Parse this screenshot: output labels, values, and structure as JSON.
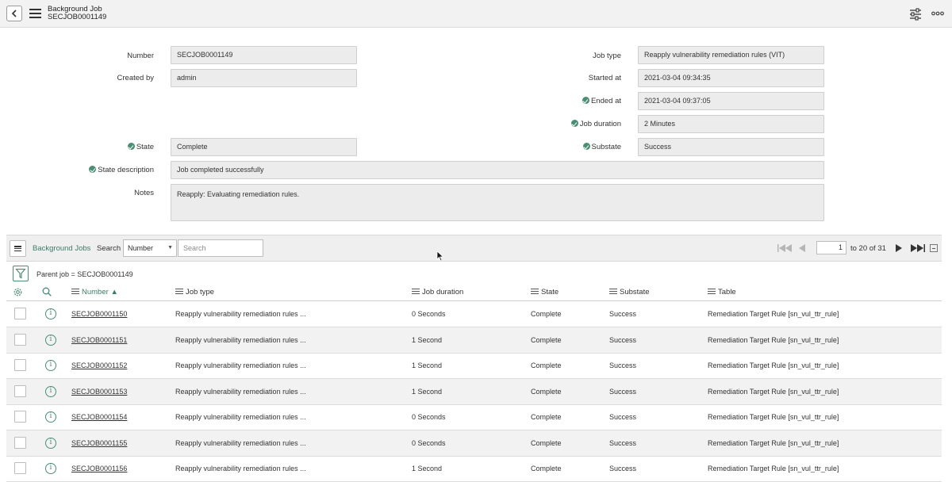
{
  "header": {
    "title": "Background Job",
    "subtitle": "SECJOB0001149",
    "back_icon": "chevron-left-icon",
    "menu_icon": "hamburger-icon",
    "settings_icon": "sliders-icon",
    "more_icon": "more-horizontal-icon"
  },
  "form": {
    "number_label": "Number",
    "number_value": "SECJOB0001149",
    "created_by_label": "Created by",
    "created_by_value": "admin",
    "job_type_label": "Job type",
    "job_type_value": "Reapply vulnerability remediation rules (VIT)",
    "started_at_label": "Started at",
    "started_at_value": "2021-03-04 09:34:35",
    "ended_at_label": "Ended at",
    "ended_at_value": "2021-03-04 09:37:05",
    "job_duration_label": "Job duration",
    "job_duration_value": "2 Minutes",
    "state_label": "State",
    "state_value": "Complete",
    "substate_label": "Substate",
    "substate_value": "Success",
    "state_description_label": "State description",
    "state_description_value": "Job completed successfully",
    "notes_label": "Notes",
    "notes_value": "Reapply: Evaluating remediation rules."
  },
  "list": {
    "title": "Background Jobs",
    "search_label": "Search",
    "search_field": "Number",
    "search_placeholder": "Search",
    "page_value": "1",
    "page_range": "to 20 of 31",
    "breadcrumb": "Parent job = SECJOB0001149",
    "columns": {
      "number": "Number",
      "job_type": "Job type",
      "job_duration": "Job duration",
      "state": "State",
      "substate": "Substate",
      "table": "Table"
    },
    "rows": [
      {
        "number": "SECJOB0001150",
        "job_type": "Reapply vulnerability remediation rules ...",
        "duration": "0 Seconds",
        "state": "Complete",
        "substate": "Success",
        "table": "Remediation Target Rule [sn_vul_ttr_rule]"
      },
      {
        "number": "SECJOB0001151",
        "job_type": "Reapply vulnerability remediation rules ...",
        "duration": "1 Second",
        "state": "Complete",
        "substate": "Success",
        "table": "Remediation Target Rule [sn_vul_ttr_rule]"
      },
      {
        "number": "SECJOB0001152",
        "job_type": "Reapply vulnerability remediation rules ...",
        "duration": "1 Second",
        "state": "Complete",
        "substate": "Success",
        "table": "Remediation Target Rule [sn_vul_ttr_rule]"
      },
      {
        "number": "SECJOB0001153",
        "job_type": "Reapply vulnerability remediation rules ...",
        "duration": "1 Second",
        "state": "Complete",
        "substate": "Success",
        "table": "Remediation Target Rule [sn_vul_ttr_rule]"
      },
      {
        "number": "SECJOB0001154",
        "job_type": "Reapply vulnerability remediation rules ...",
        "duration": "0 Seconds",
        "state": "Complete",
        "substate": "Success",
        "table": "Remediation Target Rule [sn_vul_ttr_rule]"
      },
      {
        "number": "SECJOB0001155",
        "job_type": "Reapply vulnerability remediation rules ...",
        "duration": "0 Seconds",
        "state": "Complete",
        "substate": "Success",
        "table": "Remediation Target Rule [sn_vul_ttr_rule]"
      },
      {
        "number": "SECJOB0001156",
        "job_type": "Reapply vulnerability remediation rules ...",
        "duration": "1 Second",
        "state": "Complete",
        "substate": "Success",
        "table": "Remediation Target Rule [sn_vul_ttr_rule]"
      }
    ]
  },
  "colors": {
    "accent": "#3c7c6a",
    "check": "#4a8f74"
  }
}
